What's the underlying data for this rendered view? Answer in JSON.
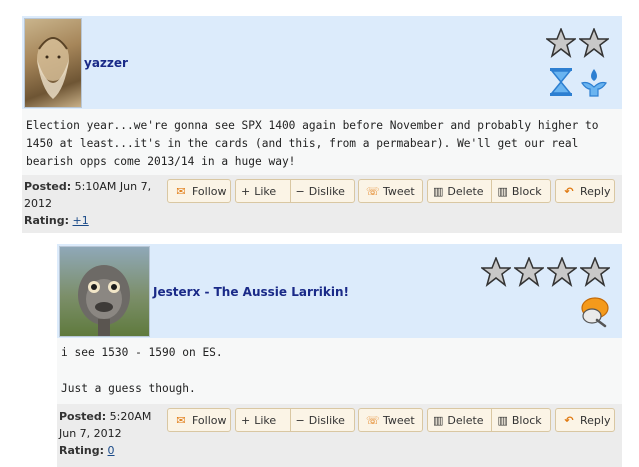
{
  "posts": [
    {
      "username": "yazzer",
      "body": "Election year...we're gonna see SPX 1400 again before November and probably higher to 1450 at least...it's in the cards (and this, from a permabear). We'll get our real bearish opps come 2013/14 in a huge way!",
      "posted_label": "Posted:",
      "posted_value": "5:10AM Jun 7, 2012",
      "rating_label": "Rating:",
      "rating_value": "+1",
      "stars": 2
    },
    {
      "username": "Jesterx - The Aussie Larrikin!",
      "body_line1": "i see 1530 - 1590 on ES.",
      "body_line2": "Just a guess though.",
      "posted_label": "Posted:",
      "posted_value": "5:20AM Jun 7, 2012",
      "rating_label": "Rating:",
      "rating_value": "0",
      "stars": 4
    }
  ],
  "actions": {
    "follow": "Follow",
    "like": "Like",
    "dislike": "Dislike",
    "tweet": "Tweet",
    "delete": "Delete",
    "block": "Block",
    "reply": "Reply"
  },
  "colors": {
    "header_bg": "#dcebfb",
    "username": "#1a2a88",
    "button_bg": "#fbf4e6",
    "icon_orange": "#e07a12"
  }
}
